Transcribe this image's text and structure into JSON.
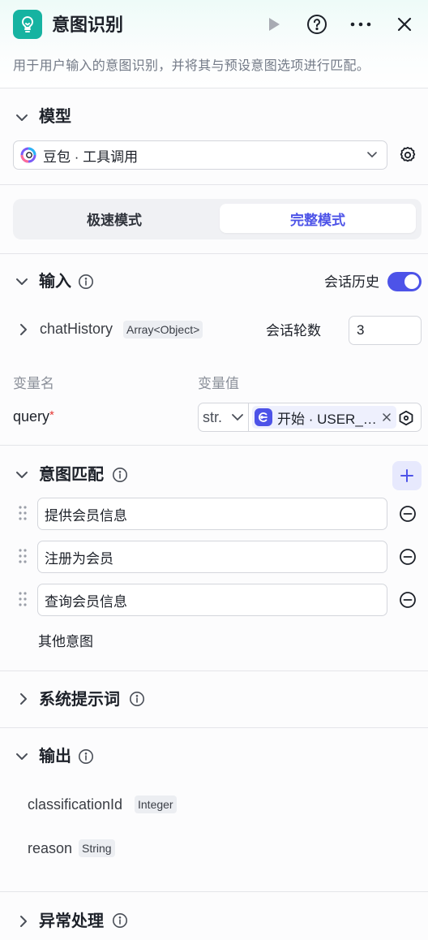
{
  "header": {
    "title": "意图识别",
    "description": "用于用户输入的意图识别，并将其与预设意图选项进行匹配。",
    "icons": [
      "lightbulb-icon",
      "play-icon",
      "help-icon",
      "more-icon",
      "close-icon"
    ],
    "accent_color": "#16b3a1"
  },
  "model": {
    "section_title": "模型",
    "selected": "豆包 · 工具调用"
  },
  "mode": {
    "tabs": [
      "极速模式",
      "完整模式"
    ],
    "active": "完整模式"
  },
  "input": {
    "section_title": "输入",
    "history_label": "会话历史",
    "history_enabled": true,
    "chat_history_name": "chatHistory",
    "chat_history_type": "Array<Object>",
    "rounds_label": "会话轮数",
    "rounds_value": "3",
    "col_name": "变量名",
    "col_value": "变量值",
    "var_name": "query",
    "required_mark": "*",
    "var_type": "str.",
    "ref_text": "开始 · USER_…"
  },
  "intents": {
    "section_title": "意图匹配",
    "items": [
      "提供会员信息",
      "注册为会员",
      "查询会员信息"
    ],
    "other_label": "其他意图"
  },
  "system_prompt": {
    "section_title": "系统提示词"
  },
  "output": {
    "section_title": "输出",
    "fields": [
      {
        "name": "classificationId",
        "type": "Integer"
      },
      {
        "name": "reason",
        "type": "String"
      }
    ]
  },
  "exception": {
    "section_title": "异常处理"
  },
  "colors": {
    "primary": "#4d53e8",
    "required": "#e53935"
  }
}
